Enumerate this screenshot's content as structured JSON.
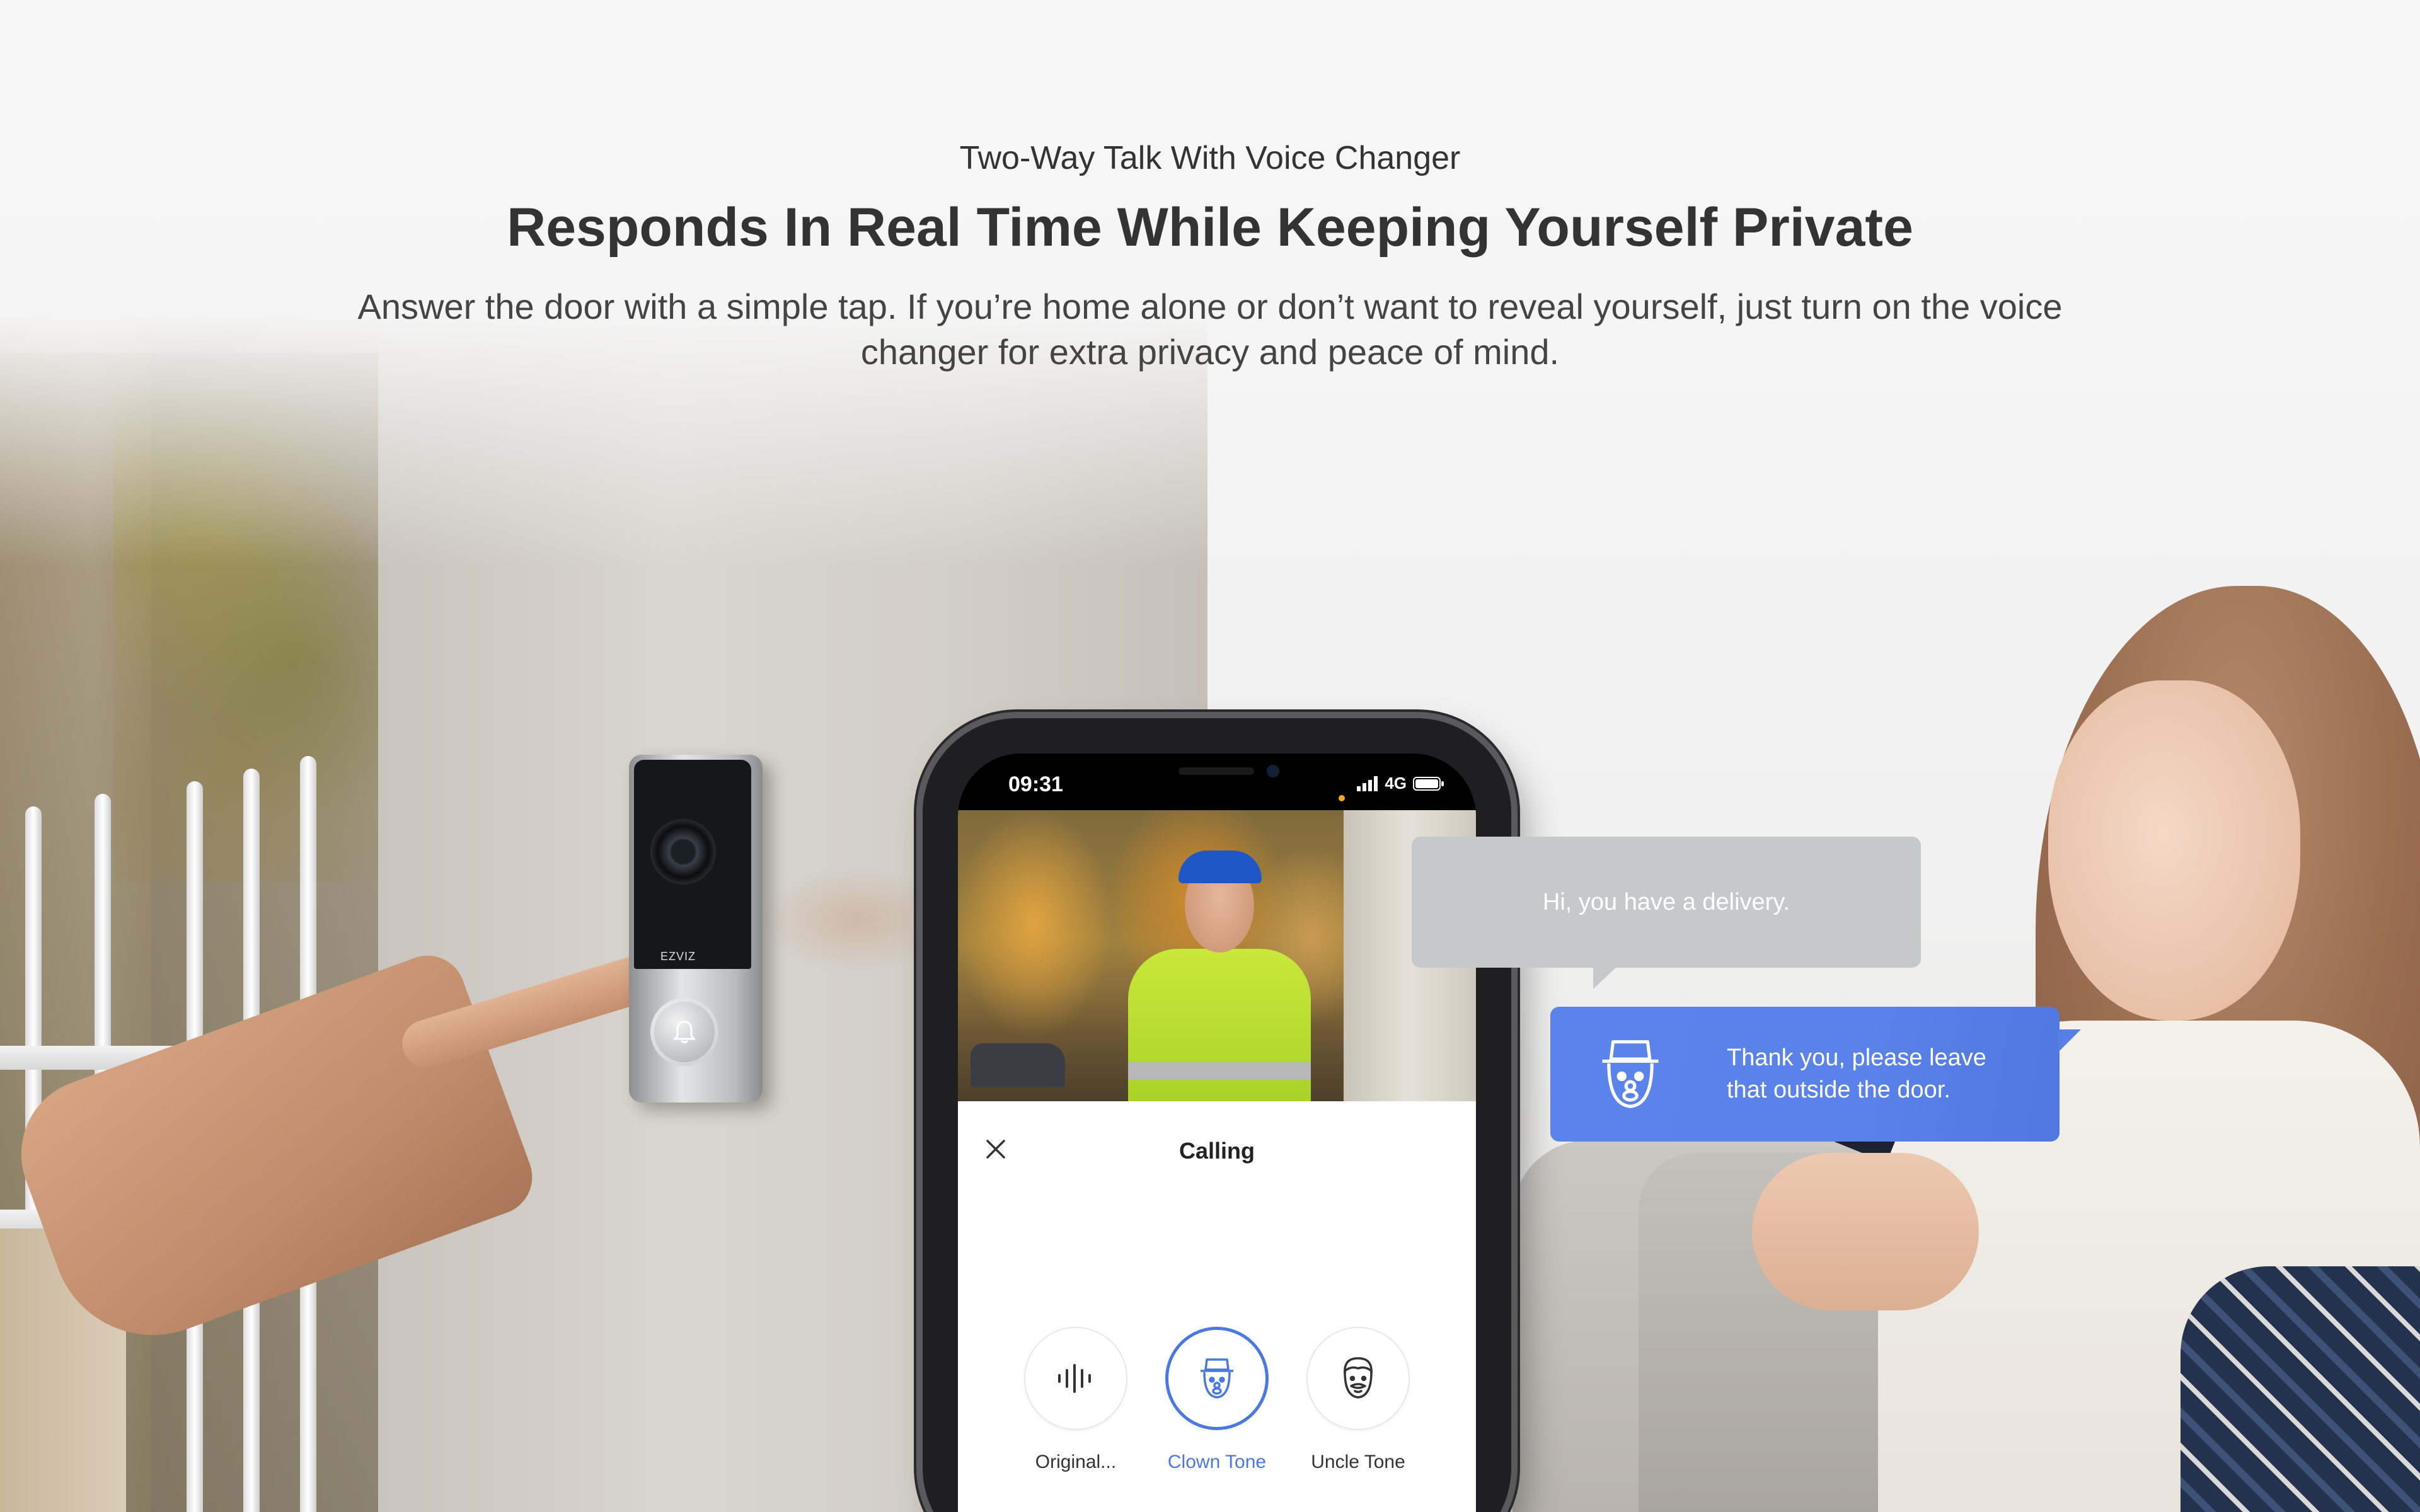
{
  "header": {
    "subtitle": "Two-Way Talk With Voice Changer",
    "title": "Responds In Real Time While Keeping Yourself Private",
    "description": "Answer the door with a simple tap. If you’re home alone or don’t want to reveal yourself,  just turn on the voice changer for extra privacy and peace of mind."
  },
  "doorbell": {
    "logo": "EZVIZ"
  },
  "phone": {
    "status": {
      "time": "09:31",
      "network": "4G"
    },
    "call": {
      "title": "Calling",
      "close_icon": "close-icon"
    },
    "tones": [
      {
        "label": "Original...",
        "icon": "waveform-icon",
        "active": false
      },
      {
        "label": "Clown Tone",
        "icon": "clown-icon",
        "active": true
      },
      {
        "label": "Uncle Tone",
        "icon": "uncle-icon",
        "active": false
      }
    ]
  },
  "chat": {
    "incoming": "Hi, you have a delivery.",
    "outgoing": "Thank you, please leave that outside the door."
  },
  "colors": {
    "accent": "#4a78e0",
    "bubble_blue": "#5a82e8",
    "bubble_gray": "#c7c8ca",
    "text_dark": "#333333"
  }
}
